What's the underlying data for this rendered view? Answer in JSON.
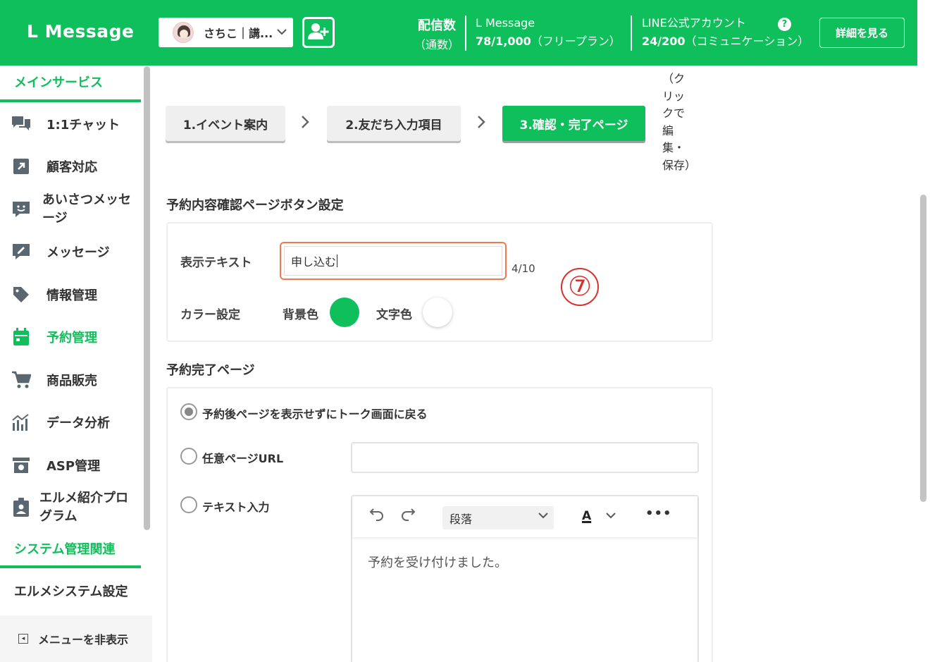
{
  "header": {
    "logo": "L Message",
    "account_name": "さちこ｜講...",
    "delivery_label_1": "配信数",
    "delivery_label_2": "（通数）",
    "plan_name": "L Message",
    "plan_value": "78/1,000",
    "plan_desc": "（フリープラン）",
    "line_label": "LINE公式アカウント",
    "line_value": "24/200",
    "line_desc": "（コミュニケーション）",
    "help": "?",
    "detail_button": "詳細を見る"
  },
  "sidebar": {
    "section_main": "メインサービス",
    "items": [
      {
        "label": "1:1チャット",
        "icon": "chat-icon"
      },
      {
        "label": "顧客対応",
        "icon": "external-link-icon"
      },
      {
        "label_1": "あいさつメッセ",
        "label_2": "ージ",
        "icon": "smile-message-icon"
      },
      {
        "label": "メッセージ",
        "icon": "edit-message-icon"
      },
      {
        "label": "情報管理",
        "icon": "tag-icon"
      },
      {
        "label": "予約管理",
        "icon": "calendar-icon",
        "active": true
      },
      {
        "label": "商品販売",
        "icon": "cart-icon"
      },
      {
        "label": "データ分析",
        "icon": "analytics-icon"
      },
      {
        "label": "ASP管理",
        "icon": "archive-icon"
      },
      {
        "label_1": "エルメ紹介プロ",
        "label_2": "グラム",
        "icon": "badge-icon"
      }
    ],
    "section_system": "システム管理関連",
    "system_item": "エルメシステム設定",
    "hide_menu": "メニューを非表示"
  },
  "steps": {
    "step1": "1.イベント案内",
    "step2": "2.友だち入力項目",
    "step3": "3.確認・完了ページ",
    "note_lines": [
      "（ク",
      "リッ",
      "クで",
      "編",
      "集・",
      "保存）"
    ]
  },
  "confirm_section": {
    "title": "予約内容確認ページボタン設定",
    "display_text_label": "表示テキスト",
    "display_text_value": "申し込む",
    "counter": "4/10",
    "marker": "⑦",
    "color_label": "カラー設定",
    "bg_color_label": "背景色",
    "text_color_label": "文字色",
    "bg_color": "#0fbf5b",
    "text_color": "#ffffff"
  },
  "complete_section": {
    "title": "予約完了ページ",
    "option_1": "予約後ページを表示せずにトーク画面に戻る",
    "option_2": "任意ページURL",
    "option_3": "テキスト入力",
    "url_value": "",
    "block_format": "段落",
    "font_color_glyph": "A",
    "more_glyph": "•••",
    "editor_text": "予約を受け付けました。"
  },
  "colors": {
    "accent": "#0fbf5b",
    "input_focus": "#f07a4e",
    "marker": "#d9302c"
  }
}
